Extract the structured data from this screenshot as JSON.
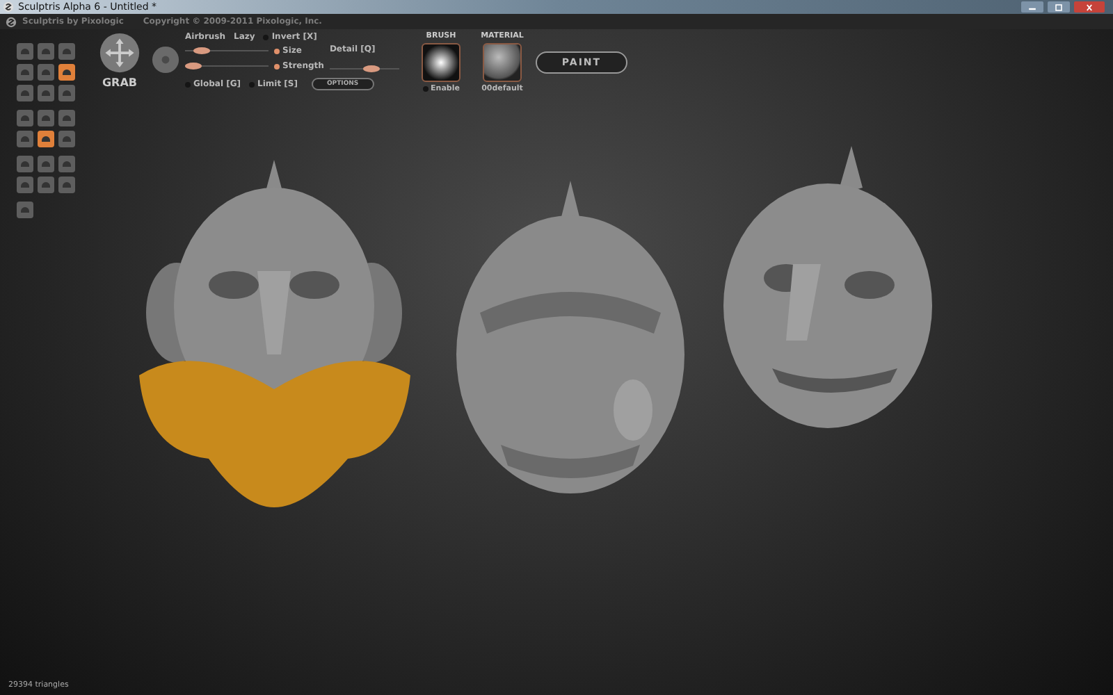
{
  "window": {
    "title": "Sculptris Alpha 6 - Untitled *"
  },
  "header": {
    "app_name": "Sculptris by Pixologic",
    "copyright": "Copyright © 2009-2011 Pixologic, Inc."
  },
  "tool_groups": [
    {
      "items": [
        {
          "selected": false
        },
        {
          "selected": false
        },
        {
          "selected": false
        },
        {
          "selected": false
        },
        {
          "selected": false
        },
        {
          "selected": true
        },
        {
          "selected": false
        },
        {
          "selected": false
        },
        {
          "selected": false
        }
      ]
    },
    {
      "items": [
        {
          "selected": false
        },
        {
          "selected": false
        },
        {
          "selected": false
        },
        {
          "selected": false
        },
        {
          "selected": true
        },
        {
          "selected": false
        }
      ]
    },
    {
      "items": [
        {
          "selected": false
        },
        {
          "selected": false
        },
        {
          "selected": false
        },
        {
          "selected": false
        },
        {
          "selected": false
        },
        {
          "selected": false
        }
      ]
    },
    {
      "items": [
        {
          "selected": false
        }
      ]
    }
  ],
  "brush_tool": {
    "label": "GRAB",
    "airbrush_on": false
  },
  "options_row": {
    "airbrush": "Airbrush",
    "lazy": "Lazy",
    "invert": {
      "label": "Invert [X]",
      "checked": false
    }
  },
  "sliders": [
    {
      "label": "Size",
      "on": true,
      "level": 0.2
    },
    {
      "label": "Strength",
      "on": true,
      "level": 0.1
    }
  ],
  "detail": {
    "label": "Detail [Q]",
    "level": 0.6
  },
  "options_button": "OPTIONS",
  "toggles": [
    {
      "label": "Global [G]",
      "checked": false
    },
    {
      "label": "Limit [S]",
      "checked": false
    }
  ],
  "brush": {
    "title": "BRUSH",
    "enable": {
      "label": "Enable",
      "checked": false
    }
  },
  "material": {
    "title": "MATERIAL",
    "name": "00default"
  },
  "paint_button": "PAINT",
  "status": "29394 triangles"
}
